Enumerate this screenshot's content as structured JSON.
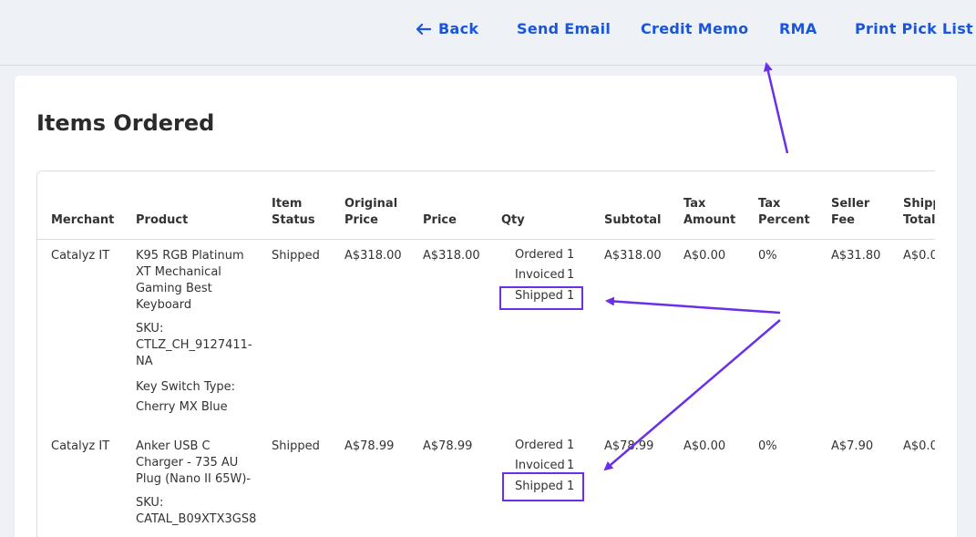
{
  "nav": {
    "back": "Back",
    "send_email": "Send Email",
    "credit_memo": "Credit Memo",
    "rma": "RMA",
    "print_pick_list": "Print Pick List"
  },
  "card": {
    "title": "Items Ordered"
  },
  "columns": {
    "merchant": "Merchant",
    "product": "Product",
    "item_status_1": "Item",
    "item_status_2": "Status",
    "original_price_1": "Original",
    "original_price_2": "Price",
    "price": "Price",
    "qty": "Qty",
    "subtotal": "Subtotal",
    "tax_amount_1": "Tax",
    "tax_amount_2": "Amount",
    "tax_percent_1": "Tax",
    "tax_percent_2": "Percent",
    "seller_fee_1": "Seller",
    "seller_fee_2": "Fee",
    "shipping_total_1": "Shipp",
    "shipping_total_2": "Total"
  },
  "rows": [
    {
      "merchant": "Catalyz IT",
      "product_lines": [
        "K95 RGB Platinum",
        "XT Mechanical",
        "Gaming Best",
        "Keyboard"
      ],
      "sku_label": "SKU:",
      "sku_lines": [
        "CTLZ_CH_9127411-",
        "NA"
      ],
      "option_label": "Key Switch Type:",
      "option_value": "Cherry MX Blue",
      "status": "Shipped",
      "original_price": "A$318.00",
      "price": "A$318.00",
      "qty_ordered_label": "Ordered",
      "qty_ordered": "1",
      "qty_invoiced_label": "Invoiced",
      "qty_invoiced": "1",
      "qty_shipped_label": "Shipped",
      "qty_shipped": "1",
      "subtotal": "A$318.00",
      "tax_amount": "A$0.00",
      "tax_percent": "0%",
      "seller_fee": "A$31.80",
      "shipping_total": "A$0.0("
    },
    {
      "merchant": "Catalyz IT",
      "product_lines": [
        "Anker USB C",
        "Charger - 735 AU",
        "Plug (Nano II 65W)-"
      ],
      "sku_label": "SKU:",
      "sku_lines": [
        "CATAL_B09XTX3GS8"
      ],
      "status": "Shipped",
      "original_price": "A$78.99",
      "price": "A$78.99",
      "qty_ordered_label": "Ordered",
      "qty_ordered": "1",
      "qty_invoiced_label": "Invoiced",
      "qty_invoiced": "1",
      "qty_shipped_label": "Shipped",
      "qty_shipped": "1",
      "subtotal": "A$78.99",
      "tax_amount": "A$0.00",
      "tax_percent": "0%",
      "seller_fee": "A$7.90",
      "shipping_total": "A$0.0("
    }
  ],
  "colors": {
    "accent": "#1a56db",
    "annotation": "#6a2fe8"
  },
  "icons": {
    "back": "arrow-left-icon"
  }
}
